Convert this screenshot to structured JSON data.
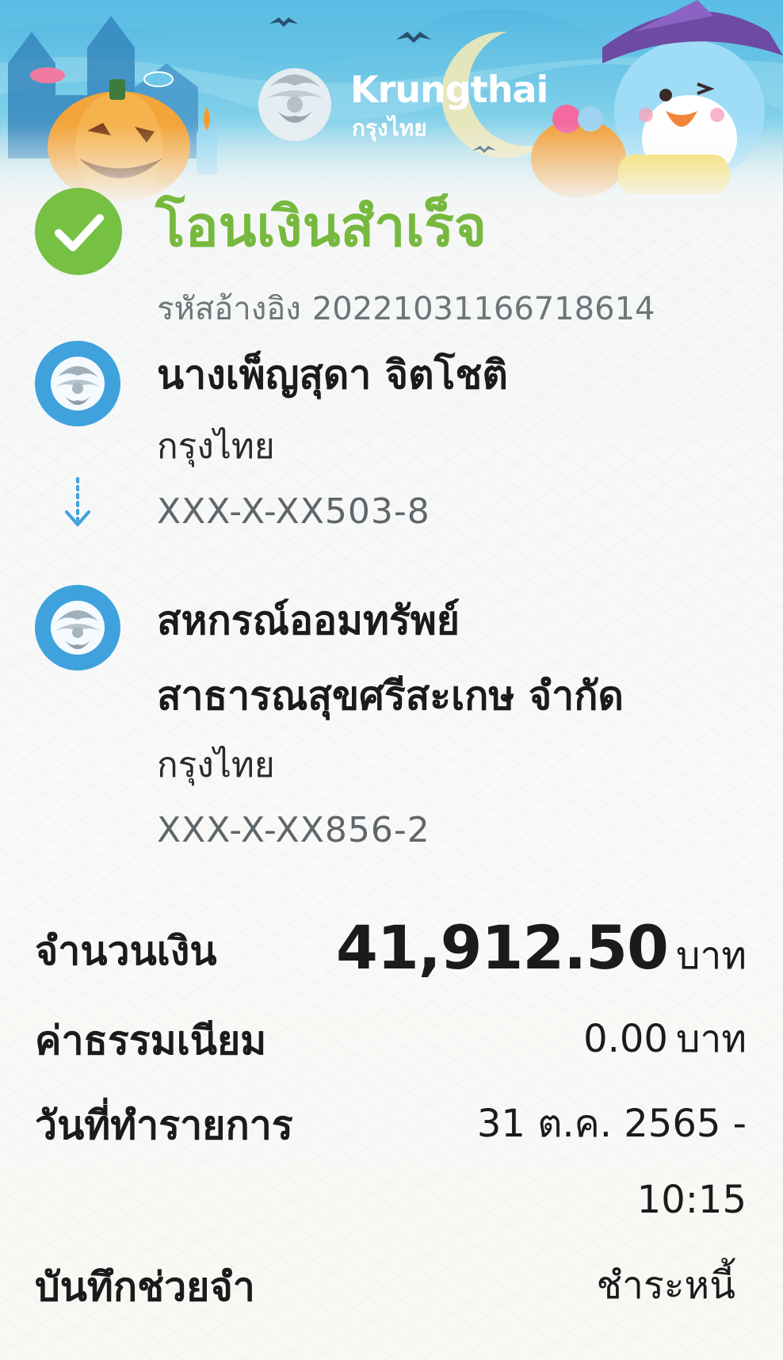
{
  "brand": {
    "name_en": "Krungthai",
    "name_th": "กรุงไทย",
    "color": "#3fa2dd"
  },
  "status": {
    "title": "โอนเงินสำเร็จ",
    "icon": "check-icon",
    "color": "#76c044"
  },
  "reference": {
    "label": "รหัสอ้างอิง",
    "value": "2022103116671861​4"
  },
  "sender": {
    "name": "นางเพ็ญสุดา จิตโชติ",
    "bank": "กรุงไทย",
    "account": "XXX-X-XX503-8",
    "icon": "krungthai-logo-icon"
  },
  "transfer_arrow_icon": "arrow-down-icon",
  "recipient": {
    "name_line1": "สหกรณ์ออมทรัพย์",
    "name_line2": "สาธารณสุขศรีสะเกษ จำกัด",
    "bank": "กรุงไทย",
    "account": "XXX-X-XX856-2",
    "icon": "krungthai-logo-icon"
  },
  "details": {
    "amount_label": "จำนวนเงิน",
    "amount_value": "41,912.50",
    "amount_unit": "บาท",
    "fee_label": "ค่าธรรมเนียม",
    "fee_value": "0.00",
    "fee_unit": "บาท",
    "date_label": "วันที่ทำรายการ",
    "date_value": "31 ต.ค. 2565 -",
    "time_value": "10:15",
    "memo_label": "บันทึกช่วยจำ",
    "memo_value": "ชำระหนี้"
  }
}
